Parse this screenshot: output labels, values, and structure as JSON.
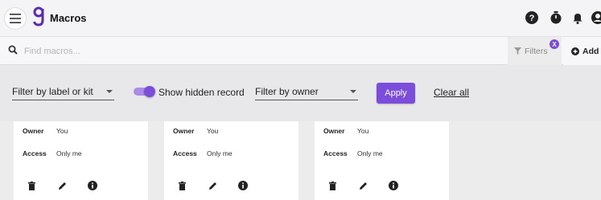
{
  "header": {
    "title": "Macros",
    "icons": [
      "menu-icon",
      "logo",
      "help-icon",
      "timer-icon",
      "bell-icon",
      "account-icon"
    ]
  },
  "search": {
    "placeholder": "Find macros...",
    "value": ""
  },
  "toolbar": {
    "filters_label": "Filters",
    "filters_badge": "X",
    "add_label": "Add"
  },
  "filters": {
    "label_or_kit": "Filter by label or kit",
    "show_hidden_label": "Show hidden record",
    "show_hidden_on": true,
    "owner": "Filter by owner",
    "apply_label": "Apply",
    "clear_label": "Clear all"
  },
  "cards": [
    {
      "owner_key": "Owner",
      "owner": "You",
      "access_key": "Access",
      "access": "Only me"
    },
    {
      "owner_key": "Owner",
      "owner": "You",
      "access_key": "Access",
      "access": "Only me"
    },
    {
      "owner_key": "Owner",
      "owner": "You",
      "access_key": "Access",
      "access": "Only me"
    }
  ],
  "colors": {
    "accent": "#7c4ddb"
  }
}
